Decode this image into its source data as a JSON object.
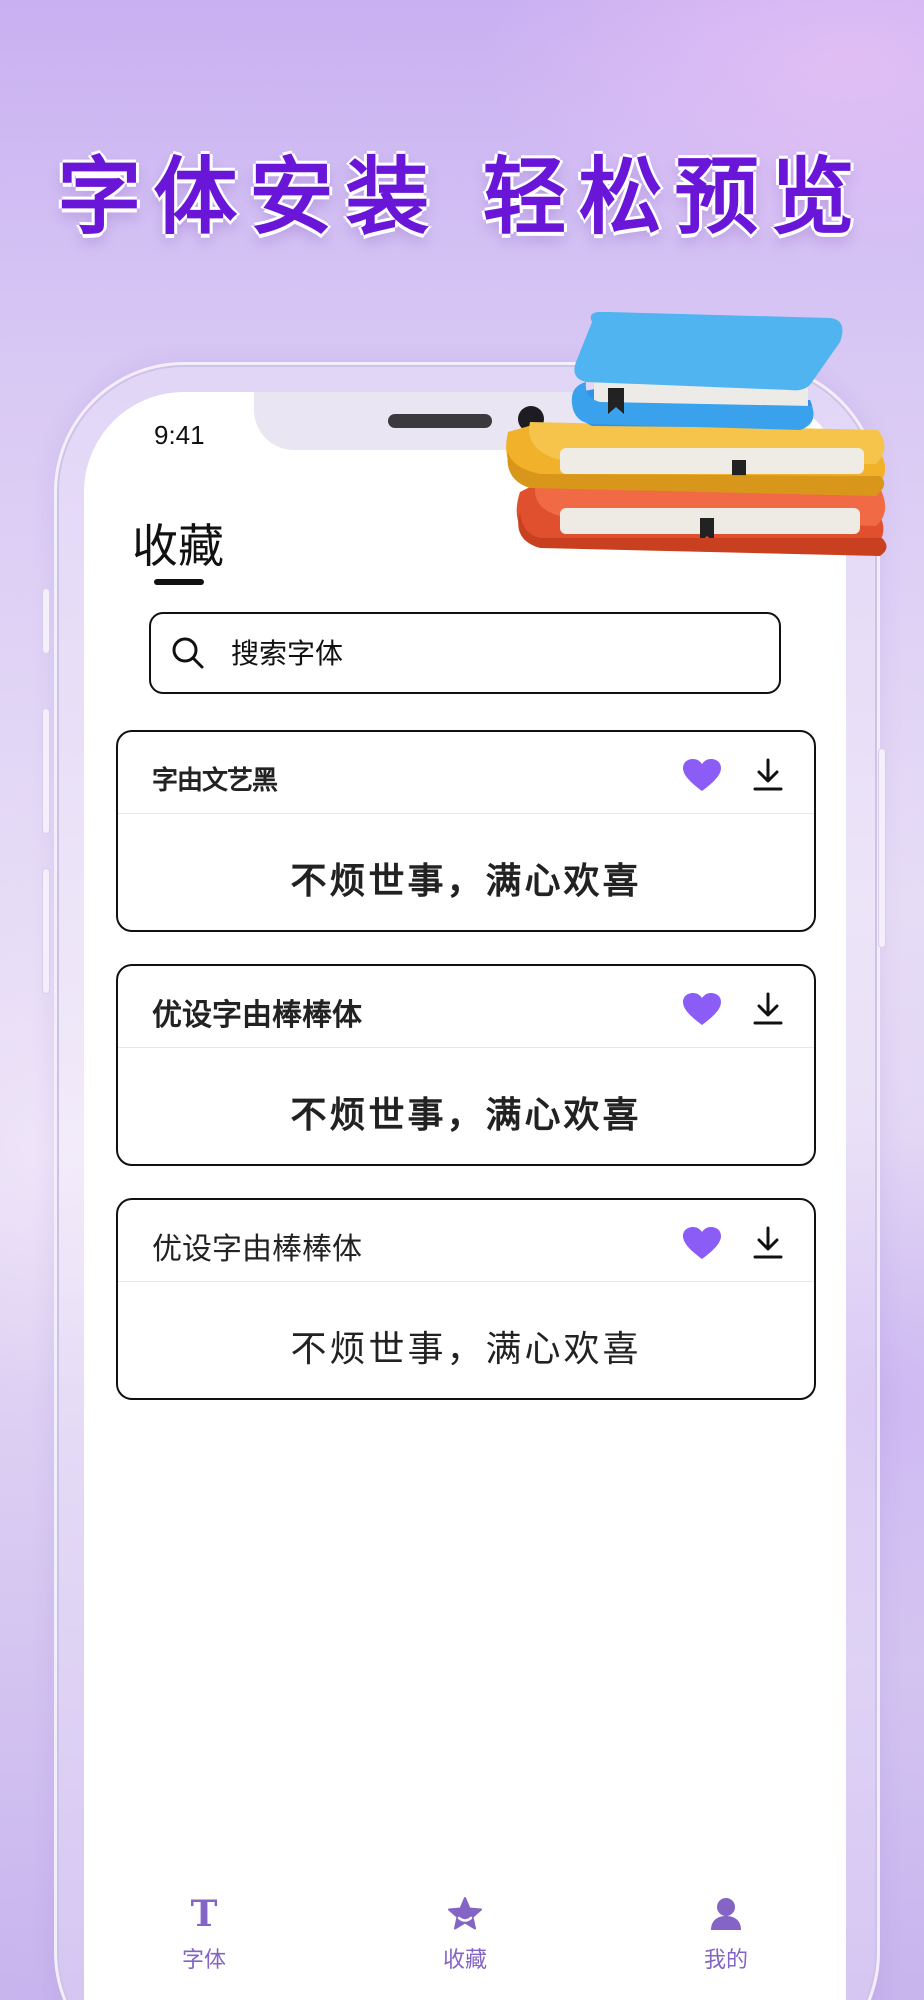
{
  "headline": "字体安装  轻松预览",
  "status_bar": {
    "time": "9:41"
  },
  "page": {
    "title": "收藏"
  },
  "search": {
    "placeholder": "搜索字体"
  },
  "fonts": [
    {
      "name": "字由文艺黑",
      "preview": "不烦世事，满心欢喜",
      "favorited": true
    },
    {
      "name": "优设字由棒棒体",
      "preview": "不烦世事，满心欢喜",
      "favorited": true
    },
    {
      "name": "优设字由棒棒体",
      "preview": "不烦世事，满心欢喜",
      "favorited": true
    }
  ],
  "tabbar": {
    "items": [
      {
        "label": "字体",
        "icon": "font-t-icon"
      },
      {
        "label": "收藏",
        "icon": "star-icon",
        "active": true
      },
      {
        "label": "我的",
        "icon": "person-icon"
      }
    ]
  },
  "colors": {
    "accent": "#8b5cf6",
    "headline": "#6a16d8",
    "tab": "#8464c4"
  }
}
